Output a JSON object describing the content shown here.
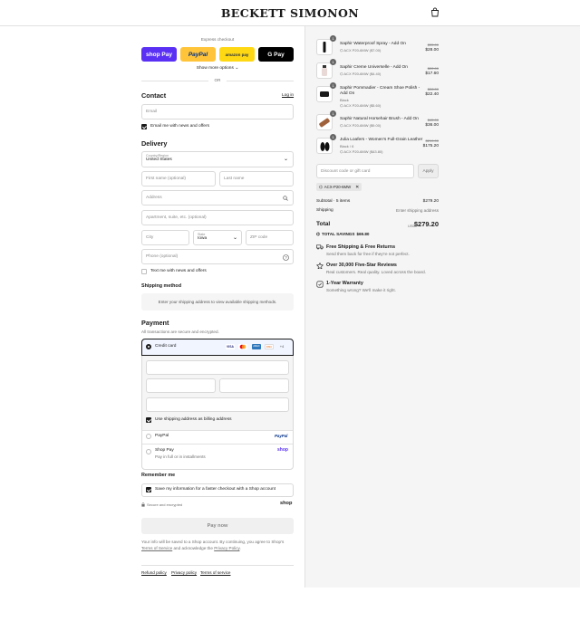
{
  "header": {
    "brand": "BECKETT SIMONON",
    "cart_icon": "shopping-bag-icon"
  },
  "express": {
    "title": "Express checkout",
    "buttons": [
      {
        "label": "shop Pay",
        "color": "#5a31f4"
      },
      {
        "label": "PayPal",
        "color": "#ffc439"
      },
      {
        "label": "amazon pay",
        "color": "#ffd814"
      },
      {
        "label": "G Pay",
        "color": "#000000"
      }
    ],
    "more": "Show more options",
    "or": "OR"
  },
  "contact": {
    "title": "Contact",
    "login": "Log in",
    "email_placeholder": "Email",
    "news_label": "Email me with news and offers"
  },
  "delivery": {
    "title": "Delivery",
    "country_label": "Country/Region",
    "country_value": "United States",
    "first_name": "First name (optional)",
    "last_name": "Last name",
    "address": "Address",
    "apartment": "Apartment, suite, etc. (optional)",
    "city": "City",
    "state_label": "State",
    "state_value": "Iowa",
    "zip": "ZIP code",
    "phone": "Phone (optional)",
    "text_news": "Text me with news and offers"
  },
  "shipping": {
    "title": "Shipping method",
    "note": "Enter your shipping address to view available shipping methods."
  },
  "payment": {
    "title": "Payment",
    "subtitle": "All transactions are secure and encrypted.",
    "credit_card": "Credit card",
    "card_brands": [
      "VISA",
      "MC",
      "AMEX",
      "DISC",
      "+4"
    ],
    "billing_same": "Use shipping address as billing address",
    "paypal": "PayPal",
    "paypal_logo": "PayPal",
    "shop_pay": "Shop Pay",
    "shop_pay_sub": "Pay in full or in installments",
    "shop_logo": "shop"
  },
  "remember": {
    "title": "Remember me",
    "save_label": "Save my information for a faster checkout with a Shop account",
    "secure": "Secure and encrypted",
    "shop_logo": "shop"
  },
  "pay_now": "Pay now",
  "legal": {
    "text1": "Your info will be saved to a Shop account. By continuing, you agree to Shop's",
    "terms": "Terms of Service",
    "and": "and acknowledge the",
    "privacy": "Privacy Policy",
    "period": "."
  },
  "footer_links": [
    "Refund policy",
    "Privacy policy",
    "Terms of service"
  ],
  "order": {
    "items": [
      {
        "qty": "1",
        "name": "Saphir Waterproof Spray - Add On",
        "variant": "",
        "code": "ACX P20-6MW ($7.00)",
        "old_price": "$35.00",
        "price": "$28.00"
      },
      {
        "qty": "1",
        "name": "Saphir Creme Universelle - Add On",
        "variant": "",
        "code": "ACX P20-6MW ($4.40)",
        "old_price": "$22.00",
        "price": "$17.60"
      },
      {
        "qty": "1",
        "name": "Saphir Pommadier - Cream Shoe Polish - Add On",
        "variant": "Black",
        "code": "ACX P20-6MW ($5.60)",
        "old_price": "$28.00",
        "price": "$22.40"
      },
      {
        "qty": "1",
        "name": "Saphir Natural Horsehair Brush - Add On",
        "variant": "",
        "code": "ACX P20-6MW ($9.00)",
        "old_price": "$45.00",
        "price": "$36.00"
      },
      {
        "qty": "1",
        "name": "Julia Loafers - Women's Full-Grain Leather",
        "variant": "Black / 6",
        "code": "ACX P20-6MW ($43.80)",
        "old_price": "$219.00",
        "price": "$175.20"
      }
    ],
    "discount_placeholder": "Discount code or gift card",
    "apply": "Apply",
    "applied_code": "ACX-P20-6MW",
    "subtotal_label": "Subtotal · 5 items",
    "subtotal_value": "$279.20",
    "shipping_label": "Shipping",
    "shipping_value": "Enter shipping address",
    "total_label": "Total",
    "currency": "USD",
    "total_value": "$279.20",
    "savings_label": "TOTAL SAVINGS",
    "savings_value": "$69.80"
  },
  "perks": [
    {
      "icon": "truck-icon",
      "title": "Free Shipping & Free Returns",
      "desc": "Send them back for free if they're not perfect."
    },
    {
      "icon": "star-icon",
      "title": "Over 30,000 Five-Star Reviews",
      "desc": "Real customers. Real quality. Loved across the board."
    },
    {
      "icon": "shield-icon",
      "title": "1-Year Warranty",
      "desc": "Something wrong? We'll make it right."
    }
  ]
}
